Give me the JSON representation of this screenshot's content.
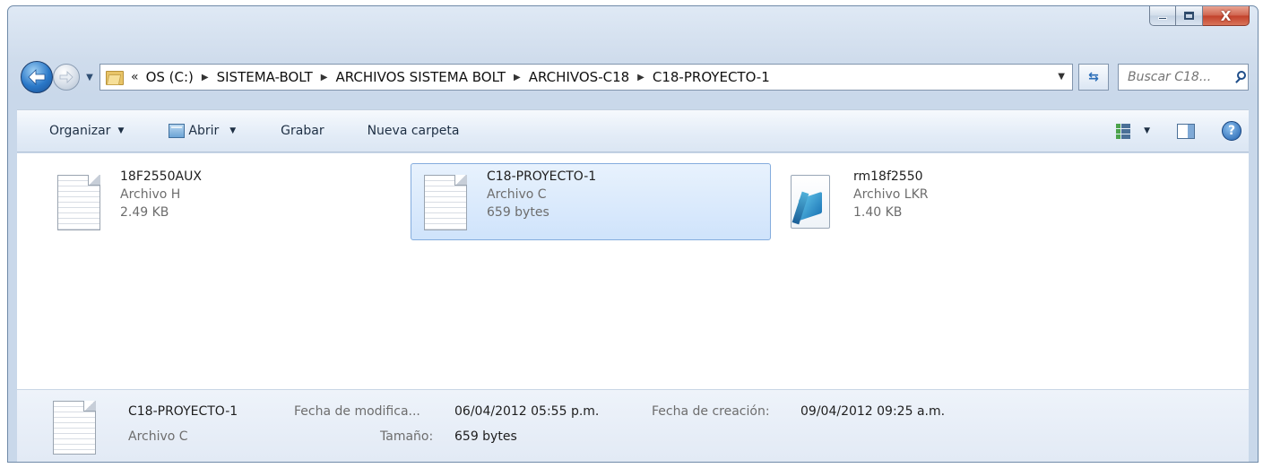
{
  "window": {
    "caption_buttons": {
      "minimize": "minimize",
      "maximize": "maximize",
      "close": "X"
    }
  },
  "nav": {
    "overflow_chevron": "«",
    "breadcrumbs": [
      "OS (C:)",
      "SISTEMA-BOLT",
      "ARCHIVOS SISTEMA BOLT",
      "ARCHIVOS-C18",
      "C18-PROYECTO-1"
    ],
    "search_placeholder": "Buscar C18..."
  },
  "toolbar": {
    "organize_label": "Organizar",
    "open_label": "Abrir",
    "burn_label": "Grabar",
    "new_folder_label": "Nueva carpeta"
  },
  "files": [
    {
      "name": "18F2550AUX",
      "type": "Archivo H",
      "size": "2.49 KB",
      "icon": "text-document-icon",
      "selected": false
    },
    {
      "name": "C18-PROYECTO-1",
      "type": "Archivo C",
      "size": "659 bytes",
      "icon": "text-document-icon",
      "selected": true
    },
    {
      "name": "rm18f2550",
      "type": "Archivo LKR",
      "size": "1.40 KB",
      "icon": "notepad-document-icon",
      "selected": false
    }
  ],
  "details": {
    "name": "C18-PROYECTO-1",
    "type": "Archivo C",
    "modified_label": "Fecha de modifica...",
    "modified_value": "06/04/2012 05:55 p.m.",
    "created_label": "Fecha de creación:",
    "created_value": "09/04/2012 09:25 a.m.",
    "size_label": "Tamaño:",
    "size_value": "659 bytes"
  },
  "colors": {
    "selection_fill": "#cfe3fb",
    "selection_border": "#84acdd",
    "toolbar_text": "#1e2f44",
    "secondary_text": "#6d6d6d"
  }
}
